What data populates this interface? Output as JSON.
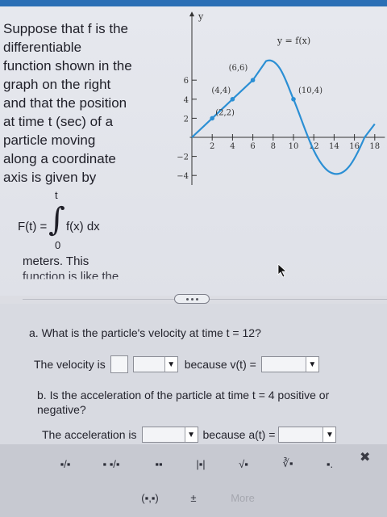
{
  "question": {
    "lines": [
      "Suppose that f is the",
      "differentiable",
      "function shown in the",
      "graph on the right",
      "and that the position",
      "at time t (sec) of a",
      "particle moving",
      "along a coordinate",
      "axis is given by"
    ],
    "integral": {
      "upper": "t",
      "lhs": "F(t) =",
      "sign": "∫",
      "body": "f(x) dx",
      "lower": "0"
    },
    "tail_line1": "meters. This",
    "tail_line2": "function is like the"
  },
  "graph": {
    "y_axis_label": "y",
    "curve_label": "y = f(x)",
    "points": [
      {
        "label": "(2,2)",
        "x": 2,
        "y": 2
      },
      {
        "label": "(4,4)",
        "x": 4,
        "y": 4
      },
      {
        "label": "(6,6)",
        "x": 6,
        "y": 6
      },
      {
        "label": "(10,4)",
        "x": 10,
        "y": 4
      }
    ],
    "x_ticks": [
      "2",
      "4",
      "6",
      "8",
      "10",
      "12",
      "14",
      "16",
      "18"
    ],
    "y_ticks": [
      "6",
      "4",
      "2",
      "−2",
      "−4"
    ]
  },
  "part_a": {
    "question": "a. What is the particle's velocity at time t = 12?",
    "prefix": "The velocity is",
    "because": "because v(t) ="
  },
  "part_b": {
    "question": "b. Is the acceleration of the particle at time t = 4 positive or negative?",
    "prefix": "The acceleration is",
    "because": "because a(t) ="
  },
  "toolbar": {
    "row1": [
      "▪/▪",
      "▪ ▪/▪",
      "▪▪",
      "|▪|",
      "√▪",
      "∛▪",
      "▪."
    ],
    "row2": [
      "(▪,▪)",
      "±",
      "More"
    ],
    "close": "✖"
  },
  "colors": {
    "curve": "#2b8fd4",
    "topbar": "#2b6fb5",
    "background": "#dcdde3"
  }
}
